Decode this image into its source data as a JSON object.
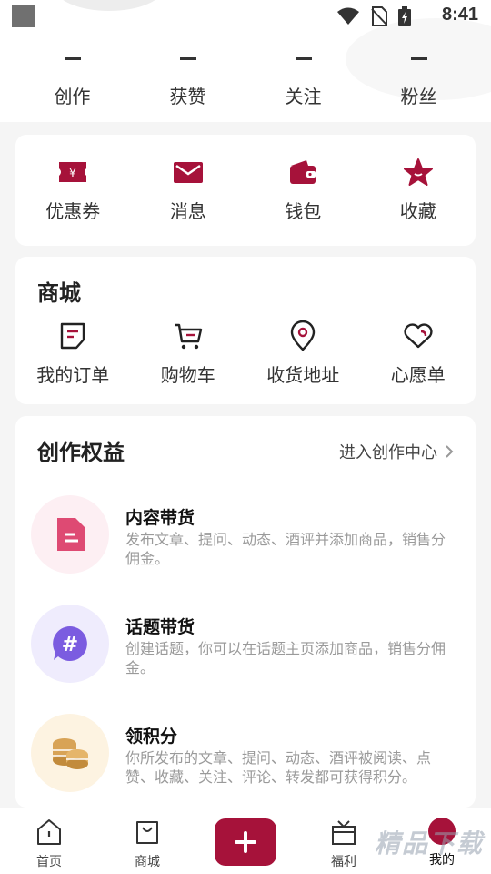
{
  "status_bar": {
    "time": "8:41"
  },
  "profile": {
    "stats": [
      {
        "value": "–",
        "label": "创作"
      },
      {
        "value": "–",
        "label": "获赞"
      },
      {
        "value": "–",
        "label": "关注"
      },
      {
        "value": "–",
        "label": "粉丝"
      }
    ]
  },
  "quick_actions": [
    {
      "label": "优惠券",
      "icon": "coupon-icon"
    },
    {
      "label": "消息",
      "icon": "mail-icon"
    },
    {
      "label": "钱包",
      "icon": "wallet-icon"
    },
    {
      "label": "收藏",
      "icon": "star-icon"
    }
  ],
  "mall": {
    "title": "商城",
    "items": [
      {
        "label": "我的订单",
        "icon": "order-icon"
      },
      {
        "label": "购物车",
        "icon": "cart-icon"
      },
      {
        "label": "收货地址",
        "icon": "location-icon"
      },
      {
        "label": "心愿单",
        "icon": "heart-icon"
      }
    ]
  },
  "rights": {
    "title": "创作权益",
    "link": "进入创作中心",
    "items": [
      {
        "title": "内容带货",
        "desc": "发布文章、提问、动态、酒评并添加商品，销售分佣金。",
        "icon": "document-icon"
      },
      {
        "title": "话题带货",
        "desc": "创建话题，你可以在话题主页添加商品，销售分佣金。",
        "icon": "hashtag-icon"
      },
      {
        "title": "领积分",
        "desc": "你所发布的文章、提问、动态、酒评被阅读、点赞、收藏、关注、评论、转发都可获得积分。",
        "icon": "coins-icon"
      }
    ]
  },
  "bottom_nav": {
    "items": [
      {
        "label": "首页",
        "icon": "home-icon"
      },
      {
        "label": "商城",
        "icon": "bag-icon"
      },
      {
        "label": "福利",
        "icon": "gift-icon"
      },
      {
        "label": "我的",
        "icon": "avatar"
      }
    ],
    "add_icon": "plus-icon"
  },
  "watermark": "精品下载",
  "colors": {
    "accent": "#a6123a",
    "background": "#f5f5f5",
    "card": "#ffffff"
  }
}
